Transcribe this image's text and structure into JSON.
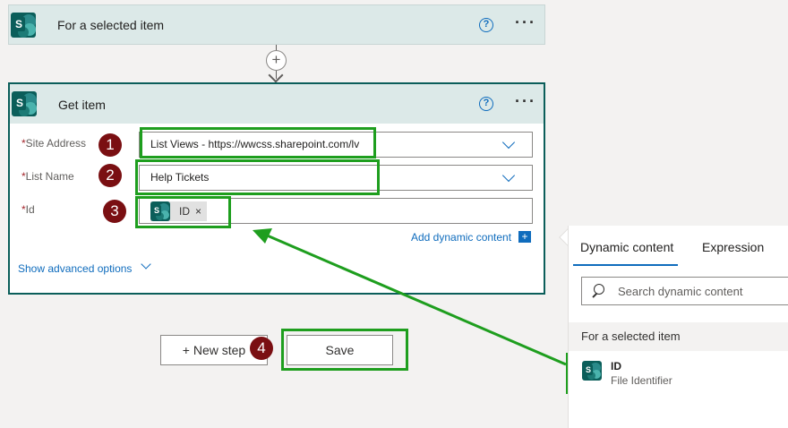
{
  "trigger": {
    "title": "For a selected item",
    "help": "?",
    "more": "···"
  },
  "connector": {
    "add": "+"
  },
  "action": {
    "title": "Get item",
    "help": "?",
    "more": "···",
    "fields": [
      {
        "label": "Site Address",
        "required": "*",
        "value": "List Views - https://wwcss.sharepoint.com/lv"
      },
      {
        "label": "List Name",
        "required": "*",
        "value": "Help Tickets"
      },
      {
        "label": "Id",
        "required": "*",
        "token": "ID",
        "token_remove": "×"
      }
    ],
    "add_dynamic": "Add dynamic content",
    "add_dynamic_plus": "+",
    "advanced": "Show advanced options"
  },
  "footer": {
    "new_step": "+ New step",
    "save": "Save"
  },
  "badges": [
    "1",
    "2",
    "3",
    "4"
  ],
  "panel": {
    "tabs": [
      "Dynamic content",
      "Expression"
    ],
    "search_placeholder": "Search dynamic content",
    "section": "For a selected item",
    "item": {
      "name": "ID",
      "description": "File Identifier"
    }
  },
  "colors": {
    "highlight": "#1e9e1e",
    "badge": "#7a0f12",
    "accent": "#0f6cbd",
    "card_header": "#dce9e8",
    "sharepoint": "#0b5e5a"
  },
  "icons": [
    "sharepoint-icon",
    "help-icon",
    "more-icon",
    "plus-icon",
    "chevron-down-icon",
    "search-icon"
  ]
}
